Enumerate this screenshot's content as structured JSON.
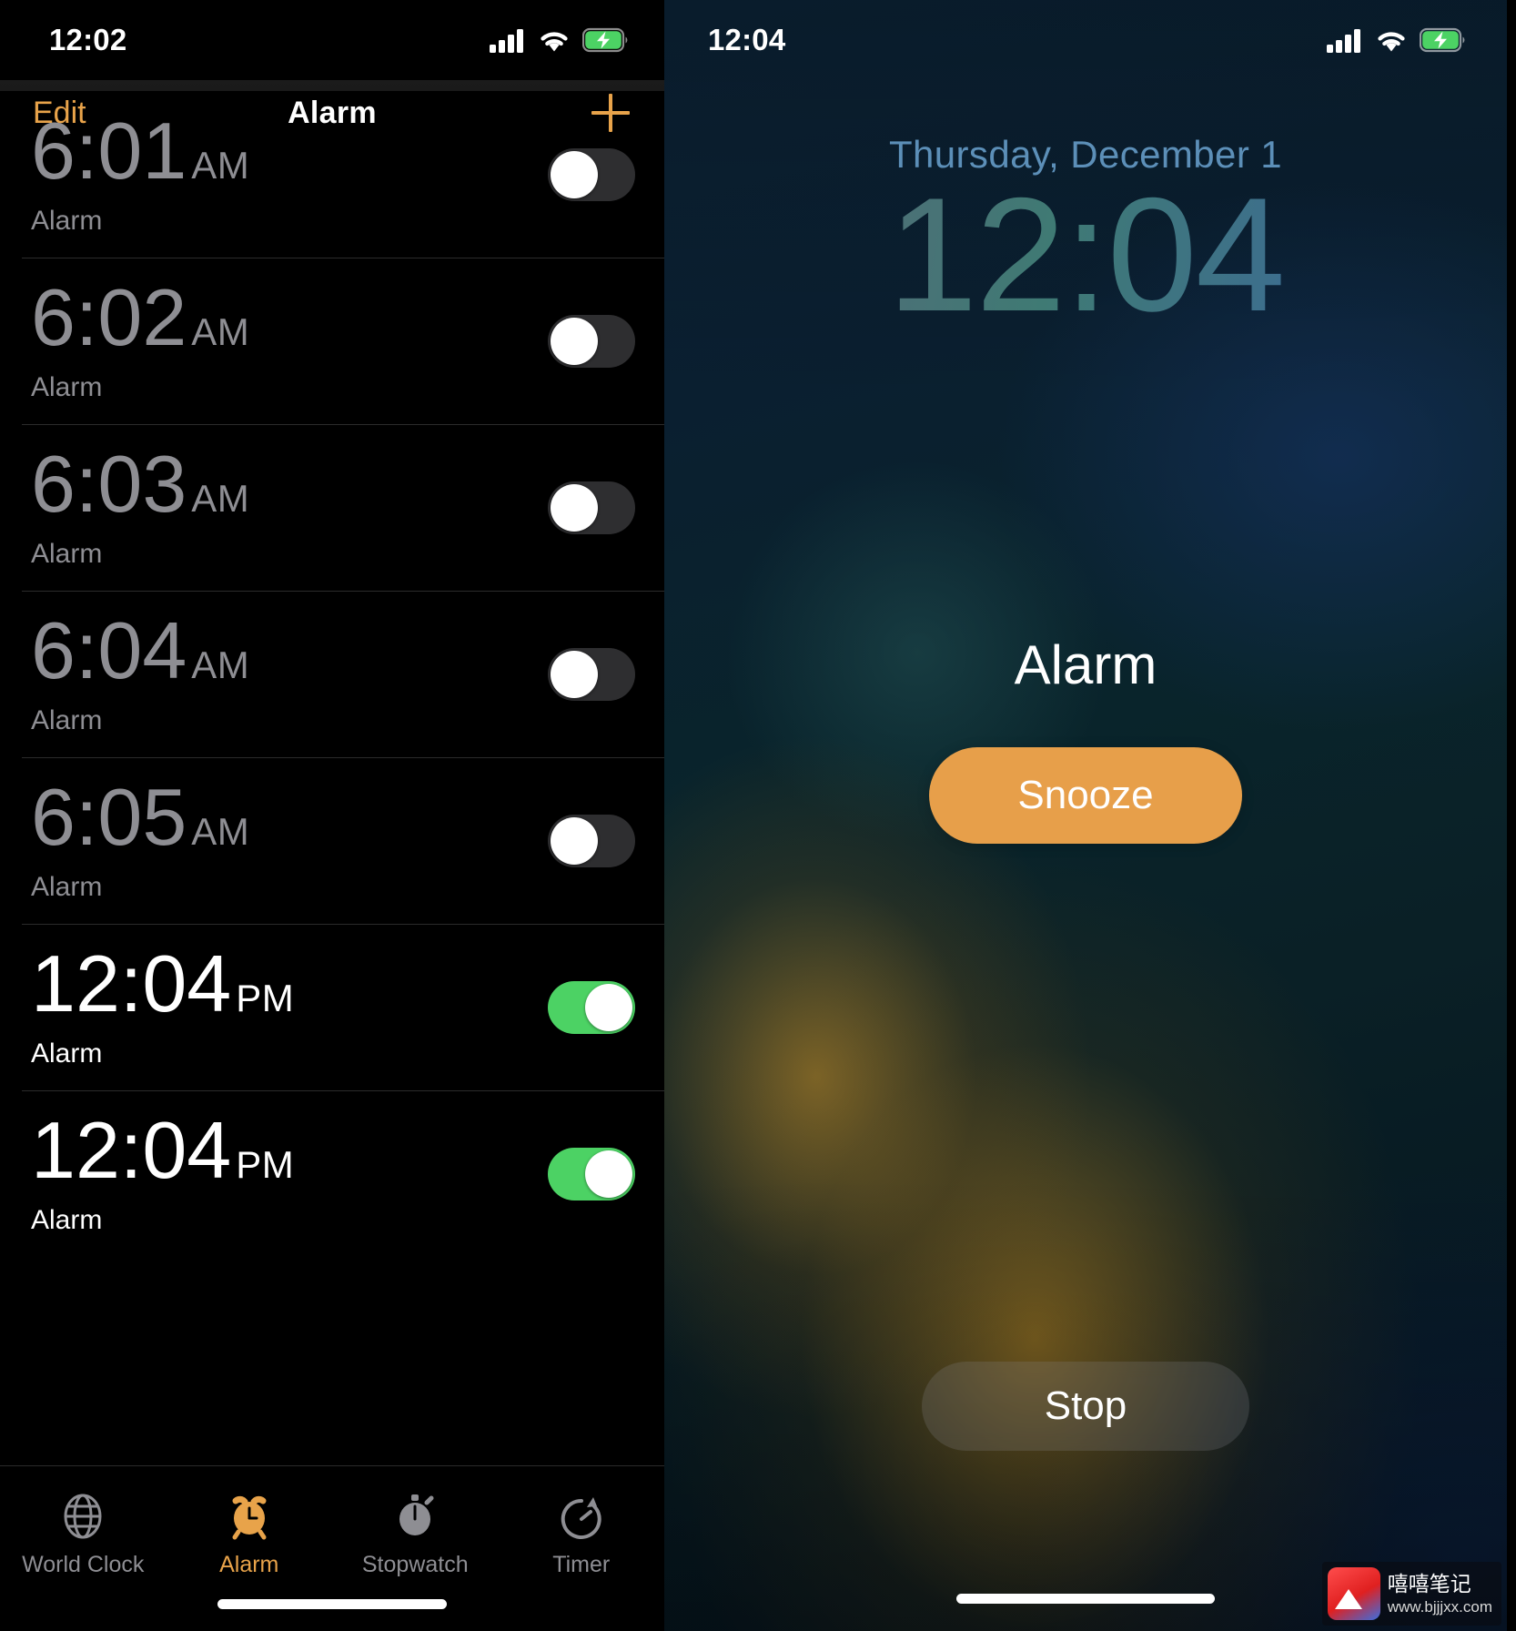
{
  "left_phone": {
    "status_bar": {
      "time": "12:02",
      "icons": [
        "cellular-bars-icon",
        "wifi-icon",
        "battery-charging-icon"
      ],
      "battery_color": "#4cd264"
    },
    "nav": {
      "edit_label": "Edit",
      "title": "Alarm",
      "add_label": "+"
    },
    "accent_color": "#e8a34a",
    "alarms": [
      {
        "time": "6:01",
        "ampm": "AM",
        "label": "Alarm",
        "enabled": false
      },
      {
        "time": "6:02",
        "ampm": "AM",
        "label": "Alarm",
        "enabled": false
      },
      {
        "time": "6:03",
        "ampm": "AM",
        "label": "Alarm",
        "enabled": false
      },
      {
        "time": "6:04",
        "ampm": "AM",
        "label": "Alarm",
        "enabled": false
      },
      {
        "time": "6:05",
        "ampm": "AM",
        "label": "Alarm",
        "enabled": false
      },
      {
        "time": "12:04",
        "ampm": "PM",
        "label": "Alarm",
        "enabled": true
      },
      {
        "time": "12:04",
        "ampm": "PM",
        "label": "Alarm",
        "enabled": true
      }
    ],
    "tabs": [
      {
        "label": "World Clock",
        "icon": "globe-icon",
        "active": false
      },
      {
        "label": "Alarm",
        "icon": "alarm-clock-icon",
        "active": true
      },
      {
        "label": "Stopwatch",
        "icon": "stopwatch-icon",
        "active": false
      },
      {
        "label": "Timer",
        "icon": "timer-icon",
        "active": false
      }
    ]
  },
  "right_phone": {
    "status_bar": {
      "time": "12:04",
      "icons": [
        "cellular-bars-icon",
        "wifi-icon",
        "battery-charging-icon"
      ],
      "battery_color": "#4cd264"
    },
    "lock_screen": {
      "date": "Thursday, December 1",
      "time": "12:04",
      "alarm_title": "Alarm",
      "snooze_label": "Snooze",
      "stop_label": "Stop",
      "snooze_color": "#e79f4a"
    }
  },
  "watermark": {
    "title": "嘻嘻笔记",
    "url": "www.bjjjxx.com"
  }
}
